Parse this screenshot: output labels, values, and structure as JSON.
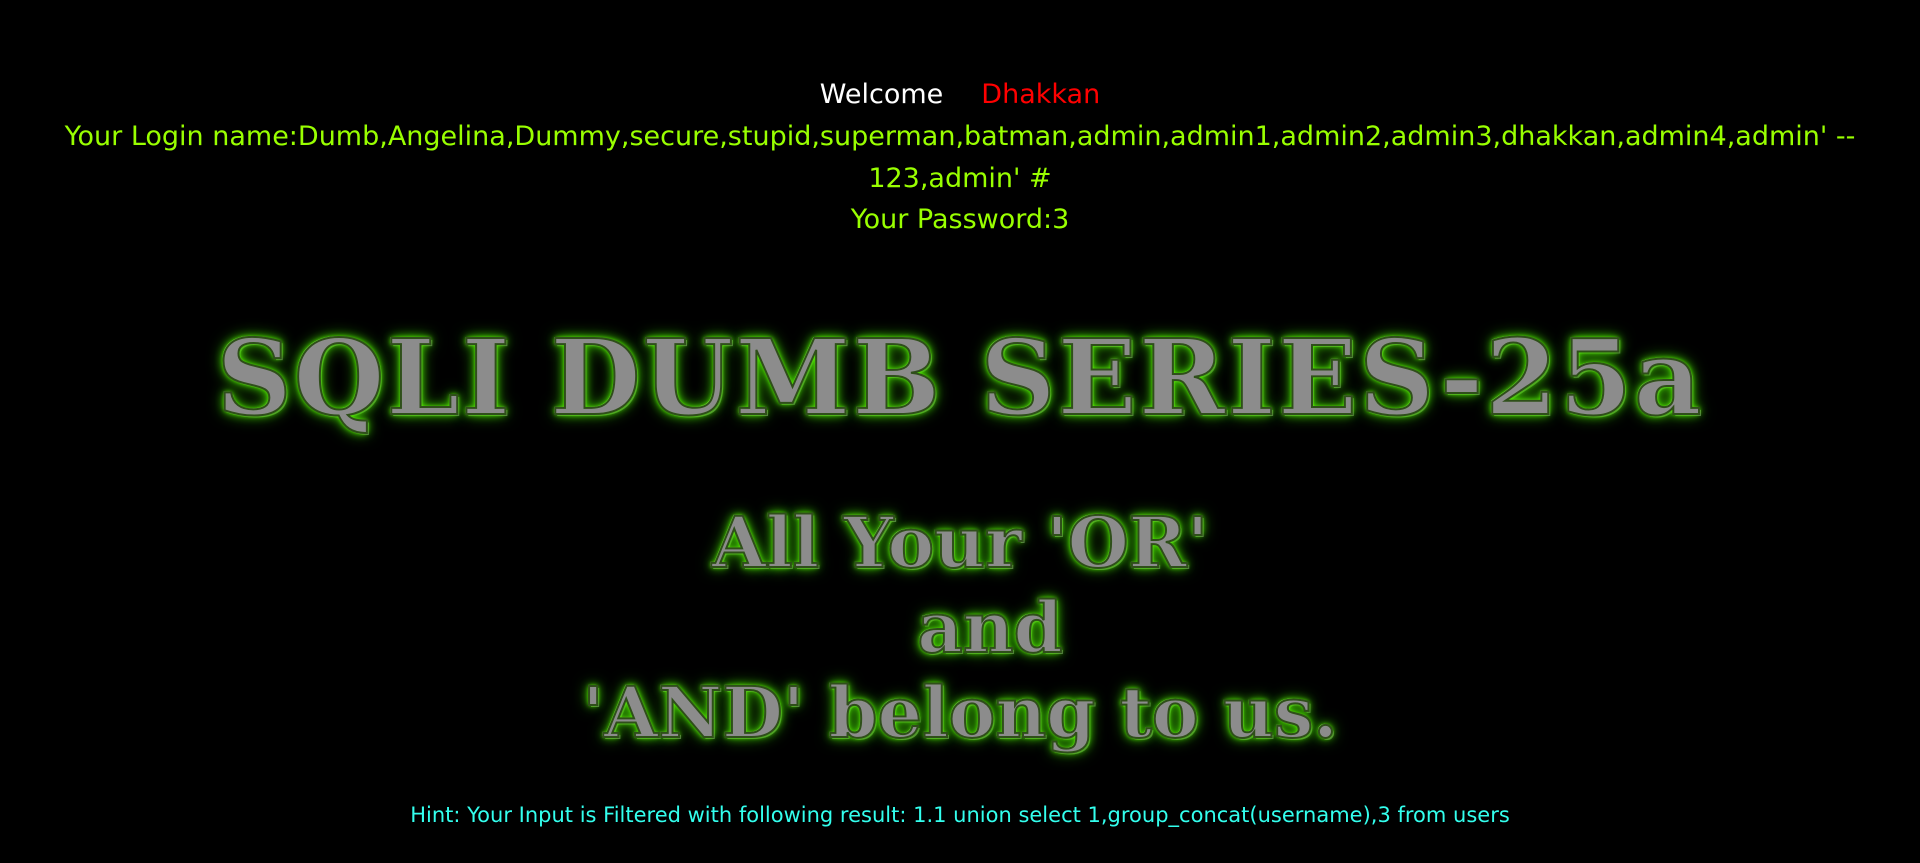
{
  "welcome": {
    "label": "Welcome",
    "username": "Dhakkan"
  },
  "login": {
    "line1": "Your Login name:Dumb,Angelina,Dummy,secure,stupid,superman,batman,admin,admin1,admin2,admin3,dhakkan,admin4,admin' --",
    "line2": "123,admin' #"
  },
  "password": {
    "text": "Your Password:3"
  },
  "banner": {
    "title": "SQLI DUMB SERIES-25a",
    "line1": "All Your 'OR'",
    "line2": "and",
    "line3": "'AND' belong to us."
  },
  "hint": {
    "text": "Hint: Your Input is Filtered with following result: 1.1 union select 1,group_concat(username),3 from users"
  },
  "colors": {
    "background": "#000000",
    "welcome": "#ffffff",
    "username": "#ff0000",
    "login": "#99ff00",
    "hint": "#33ffee",
    "banner_glow": "#66ff00"
  }
}
